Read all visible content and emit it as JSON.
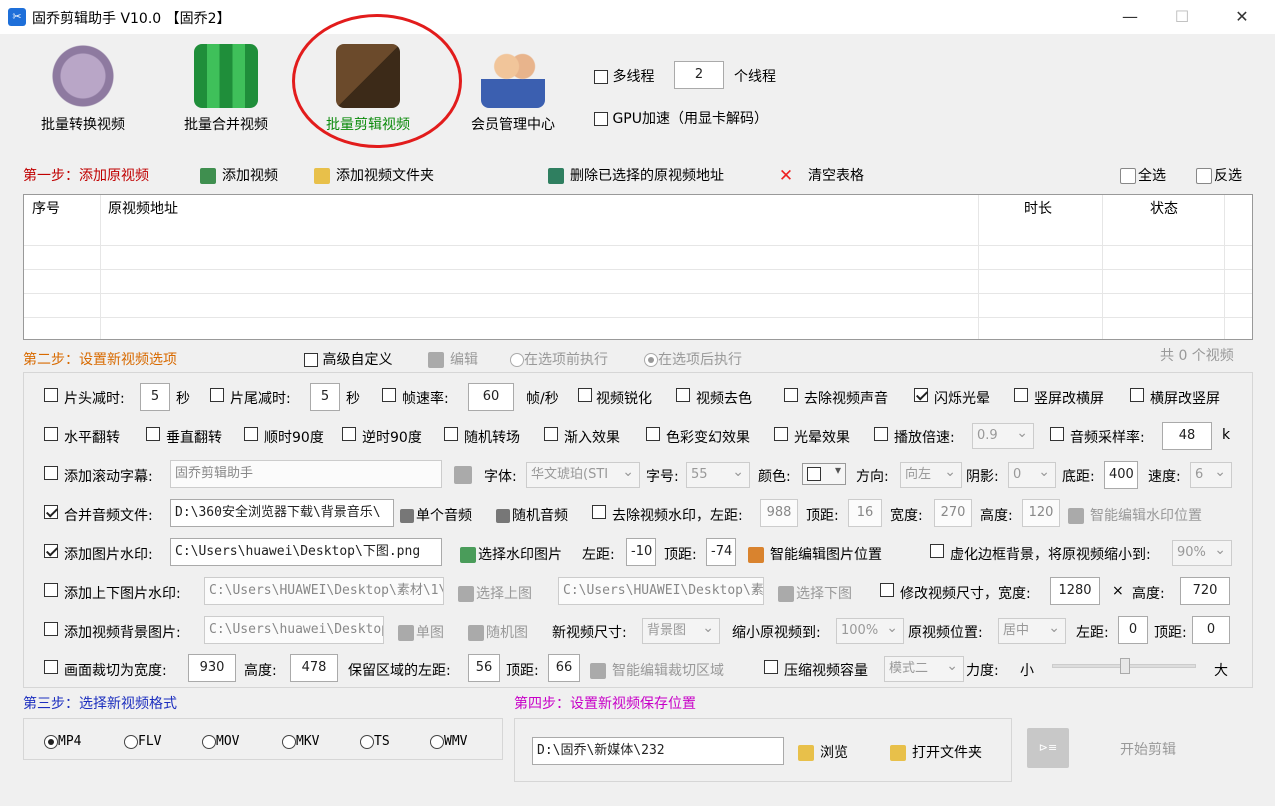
{
  "window": {
    "title": "固乔剪辑助手 V10.0 【固乔2】",
    "app_icon": "scissors-app-icon",
    "minimize": "—",
    "maximize": "☐",
    "close": "✕"
  },
  "tools": [
    {
      "label": "批量转换视频",
      "icon": "film-reel-icon"
    },
    {
      "label": "批量合并视频",
      "icon": "film-merge-icon"
    },
    {
      "label": "批量剪辑视频",
      "icon": "film-cut-icon"
    },
    {
      "label": "会员管理中心",
      "icon": "users-icon"
    }
  ],
  "threads": {
    "multithread_label": "多线程",
    "multithread_checked": false,
    "count": "2",
    "unit": "个线程",
    "gpu_label": "GPU加速（用显卡解码）",
    "gpu_checked": false
  },
  "step1": {
    "title": "第一步：添加原视频",
    "add_video": "添加视频",
    "add_folder": "添加视频文件夹",
    "delete_selected": "删除已选择的原视频地址",
    "clear_table": "清空表格",
    "select_all": "全选",
    "invert": "反选",
    "columns": [
      "序号",
      "原视频地址",
      "时长",
      "状态"
    ]
  },
  "step2": {
    "title": "第二步：设置新视频选项",
    "advanced": "高级自定义",
    "edit": "编辑",
    "before": "在选项前执行",
    "after": "在选项后执行",
    "count_text": "共 0 个视频"
  },
  "opts": {
    "head_cut": "片头减时:",
    "head_val": "5",
    "sec": "秒",
    "tail_cut": "片尾减时:",
    "tail_val": "5",
    "fps": "帧速率:",
    "fps_val": "60",
    "fps_unit": "帧/秒",
    "sharpen": "视频锐化",
    "decolor": "视频去色",
    "mute": "去除视频声音",
    "flash": "闪烁光晕",
    "v2h": "竖屏改横屏",
    "h2v": "横屏改竖屏",
    "hflip": "水平翻转",
    "vflip": "垂直翻转",
    "cw90": "顺时90度",
    "ccw90": "逆时90度",
    "random_trans": "随机转场",
    "fadein": "渐入效果",
    "color_fx": "色彩变幻效果",
    "halo": "光晕效果",
    "speed": "播放倍速:",
    "speed_val": "0.9",
    "sample": "音频采样率:",
    "sample_val": "48",
    "sample_unit": "k",
    "subtitle": "添加滚动字幕:",
    "subtitle_val": "固乔剪辑助手",
    "font": "字体:",
    "font_val": "华文琥珀(STI",
    "size": "字号:",
    "size_val": "55",
    "color": "颜色:",
    "direction": "方向:",
    "dir_val": "向左",
    "shadow": "阴影:",
    "shadow_val": "0",
    "bottom": "底距:",
    "bottom_val": "400",
    "speed2": "速度:",
    "speed2_val": "6",
    "merge_audio": "合并音频文件:",
    "audio_path": "D:\\360安全浏览器下载\\背景音乐\\",
    "single_audio": "单个音频",
    "random_audio": "随机音频",
    "remove_wm": "去除视频水印，左距:",
    "wm_left": "988",
    "top": "顶距:",
    "wm_top": "16",
    "width": "宽度:",
    "wm_w": "270",
    "height": "高度:",
    "wm_h": "120",
    "smart_wm": "智能编辑水印位置",
    "img_wm": "添加图片水印:",
    "img_path": "C:\\Users\\huawei\\Desktop\\下图.png",
    "choose_wm": "选择水印图片",
    "left": "左距:",
    "img_left": "-10",
    "img_top": "-74",
    "smart_img": "智能编辑图片位置",
    "blur_bg": "虚化边框背景，将原视频缩小到:",
    "blur_val": "90%",
    "tb_img": "添加上下图片水印:",
    "tb_path1": "C:\\Users\\HUAWEI\\Desktop\\素材\\1\\B",
    "choose_up": "选择上图",
    "tb_path2": "C:\\Users\\HUAWEI\\Desktop\\素材",
    "choose_down": "选择下图",
    "resize": "修改视频尺寸，宽度:",
    "resize_w": "1280",
    "times": "×",
    "height2": "高度:",
    "resize_h": "720",
    "bg_img": "添加视频背景图片:",
    "bg_path": "C:\\Users\\huawei\\Desktop\\",
    "single_img": "单图",
    "random_img": "随机图",
    "new_size": "新视频尺寸:",
    "new_size_val": "背景图",
    "shrink": "缩小原视频到:",
    "shrink_val": "100%",
    "orig_pos": "原视频位置:",
    "orig_pos_val": "居中",
    "pos_left": "0",
    "pos_top": "0",
    "crop": "画面裁切为宽度:",
    "crop_w": "930",
    "crop_h": "478",
    "keep": "保留区域的左距:",
    "keep_left": "56",
    "keep_top": "66",
    "smart_crop": "智能编辑裁切区域",
    "compress": "压缩视频容量",
    "compress_mode": "模式二",
    "strength": "力度:",
    "small": "小",
    "large": "大",
    "strength_level": 0.5
  },
  "step3": {
    "title": "第三步：选择新视频格式",
    "formats": [
      "MP4",
      "FLV",
      "MOV",
      "MKV",
      "TS",
      "WMV"
    ],
    "selected": "MP4"
  },
  "step4": {
    "title": "第四步：设置新视频保存位置",
    "path": "D:\\固乔\\新媒体\\232",
    "browse": "浏览",
    "open_folder": "打开文件夹",
    "start": "开始剪辑"
  },
  "colors": {
    "accent_red": "#c00000",
    "step_blue": "#1d2fbf",
    "step_magenta": "#c800c8",
    "highlight_green": "#0a8a0a",
    "annotation_circle": "#e21c1c"
  }
}
